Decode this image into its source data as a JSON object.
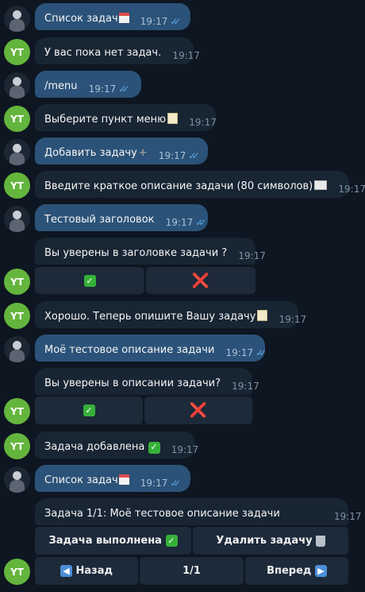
{
  "messages": [
    {
      "text": "Список задач",
      "time": "19:17",
      "ticks": "✓✓"
    },
    {
      "text": "У вас пока нет задач.",
      "time": "19:17"
    },
    {
      "text": "/menu",
      "time": "19:17",
      "ticks": "✓✓"
    },
    {
      "text": "Выберите пункт меню",
      "time": "19:17"
    },
    {
      "text": "Добавить задачу",
      "time": "19:17",
      "ticks": "✓✓"
    },
    {
      "text": "Введите краткое описание задачи (80 символов)",
      "time": "19:17"
    },
    {
      "text": "Тестовый заголовок",
      "time": "19:17",
      "ticks": "✓✓"
    },
    {
      "text": "Вы уверены в заголовке задачи ?",
      "time": "19:17"
    },
    {
      "text": "Хорошо. Теперь опишите Вашу задачу",
      "time": "19:17"
    },
    {
      "text": "Моё тестовое описание задачи",
      "time": "19:17",
      "ticks": "✓✓"
    },
    {
      "text": "Вы уверены в описании задачи?",
      "time": "19:17"
    },
    {
      "text": "Задача добавлена",
      "time": "19:17"
    },
    {
      "text": "Список задач",
      "time": "19:17",
      "ticks": "✓✓"
    },
    {
      "text": "Задача 1/1: Моё тестовое описание задачи",
      "time": "19:17"
    }
  ],
  "avatars": {
    "bot_initials": "YT"
  },
  "keyboards": {
    "confirm_yes": "✅",
    "confirm_no": "❌",
    "task_done": "Задача выполнена",
    "task_delete": "Удалить задачу",
    "nav_back": "Назад",
    "nav_page": "1/1",
    "nav_forward": "Вперед"
  },
  "colors": {
    "background": "#0e1621",
    "outgoing_bubble": "#2b5278",
    "incoming_bubble": "#182533",
    "bot_avatar": "#64b53d",
    "read_ticks": "#5fa8e7"
  }
}
